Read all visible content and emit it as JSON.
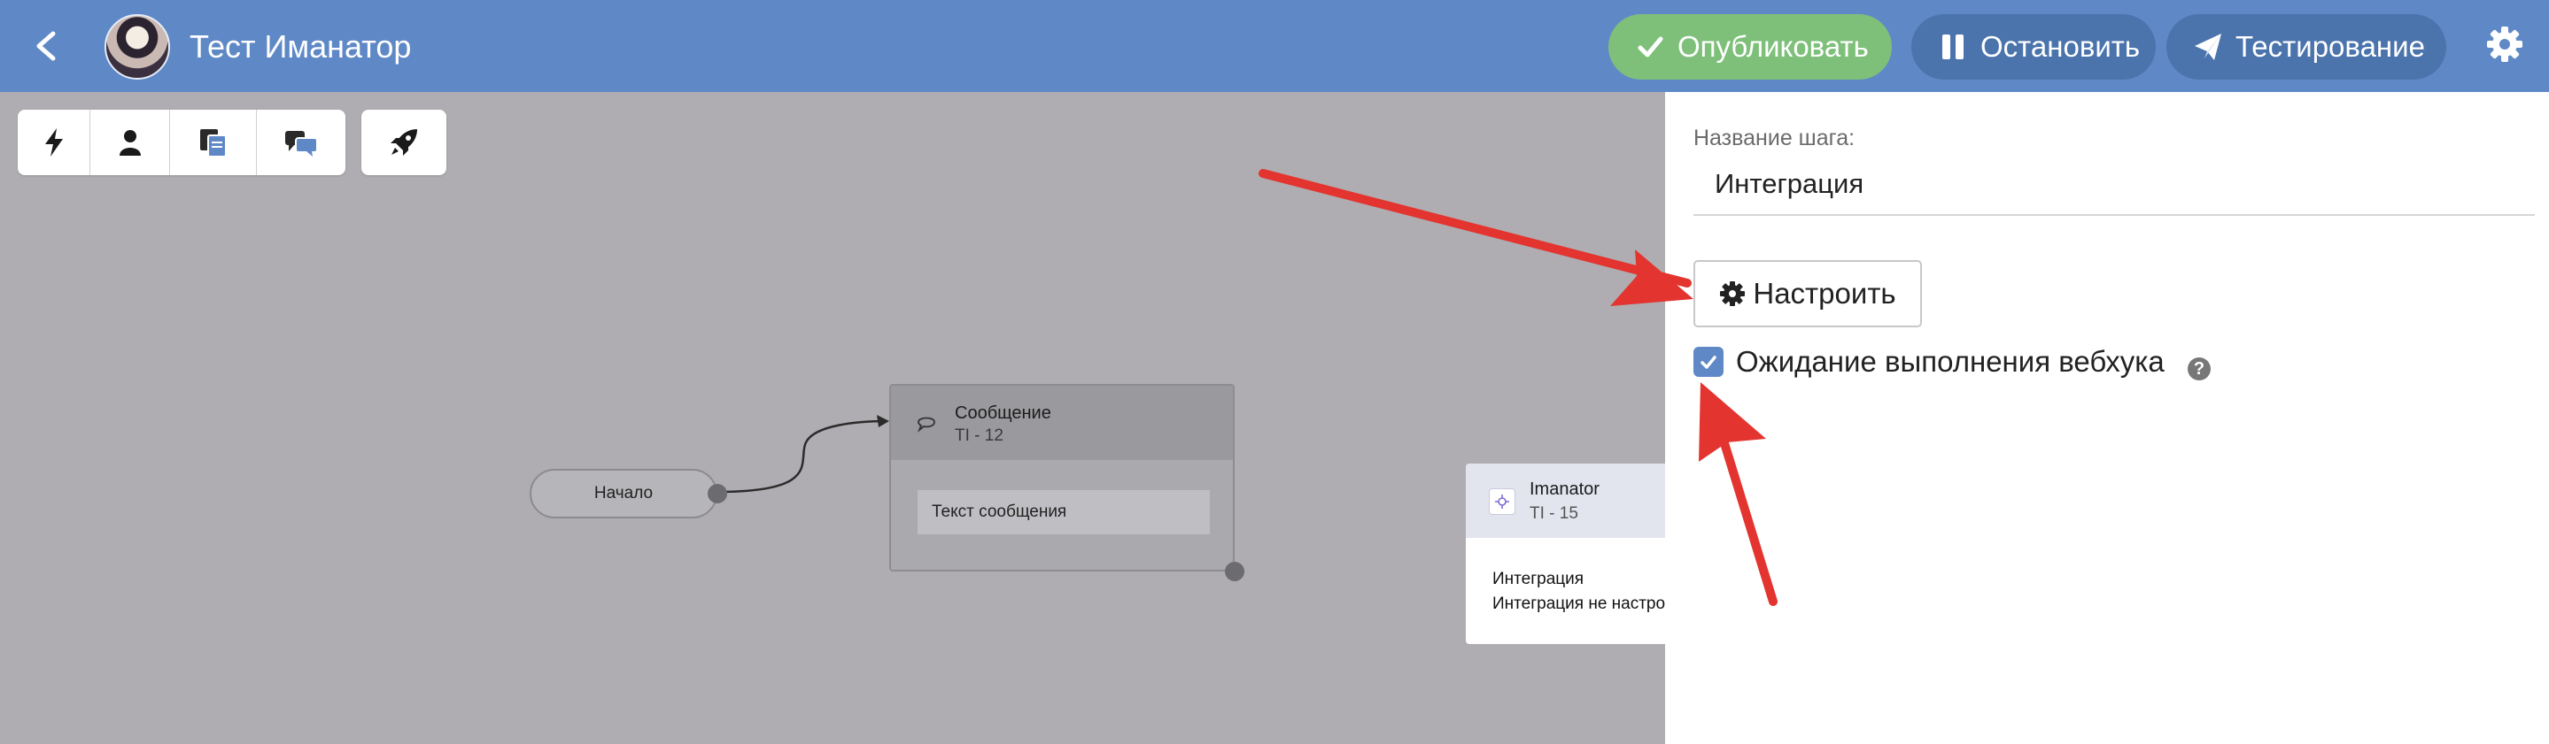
{
  "header": {
    "title": "Тест Иманатор",
    "publish_label": "Опубликовать",
    "stop_label": "Остановить",
    "test_label": "Тестирование",
    "publish_color": "#7ec07a",
    "bar_color": "#5f89c6"
  },
  "toolbar": {
    "tools": [
      {
        "icon": "bolt-icon"
      },
      {
        "icon": "user-icon"
      },
      {
        "icon": "documents-icon"
      },
      {
        "icon": "chat-icon"
      },
      {
        "icon": "rocket-icon"
      }
    ]
  },
  "canvas": {
    "start_node": {
      "label": "Начало"
    },
    "message_node": {
      "title": "Сообщение",
      "id": "TI - 12",
      "text": "Текст сообщения"
    },
    "integration_node": {
      "title": "Imanator",
      "id": "TI - 15",
      "line1": "Интеграция",
      "line2": "Интеграция не настрое"
    }
  },
  "panel": {
    "step_name_label": "Название шага:",
    "step_name_value": "Интеграция",
    "configure_label": "Настроить",
    "wait_label": "Ожидание выполнения вебхука",
    "wait_checked": true,
    "help_symbol": "?"
  },
  "annotation_color": "#e3342f"
}
